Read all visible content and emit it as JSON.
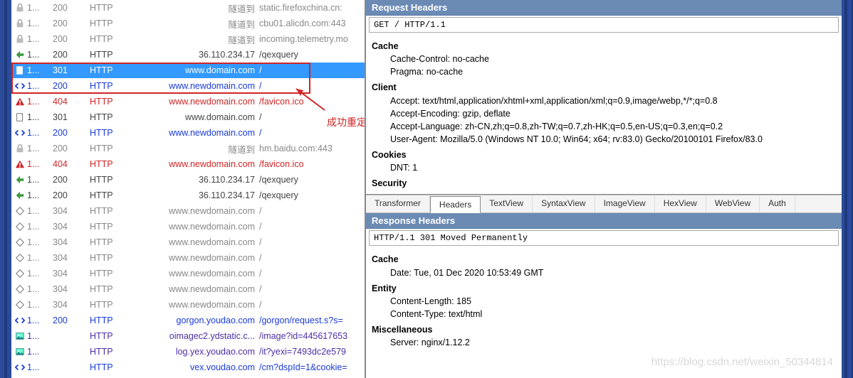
{
  "annotation": "成功重定向",
  "watermark": "https://blog.csdn.net/weixin_50344814",
  "rows": [
    {
      "icon": "lock",
      "num": "1...",
      "status": "200",
      "proto": "HTTP",
      "host": "隧道到",
      "path": "static.firefoxchina.cn:",
      "cls": "gray"
    },
    {
      "icon": "lock",
      "num": "1...",
      "status": "200",
      "proto": "HTTP",
      "host": "隧道到",
      "path": "cbu01.alicdn.com:443",
      "cls": "gray"
    },
    {
      "icon": "lock",
      "num": "1...",
      "status": "200",
      "proto": "HTTP",
      "host": "隧道到",
      "path": "incoming.telemetry.mo",
      "cls": "gray"
    },
    {
      "icon": "send",
      "num": "1...",
      "status": "200",
      "proto": "HTTP",
      "host": "36.110.234.17",
      "path": "/qexquery",
      "cls": ""
    },
    {
      "icon": "page",
      "num": "1...",
      "status": "301",
      "proto": "HTTP",
      "host": "www.domain.com",
      "path": "/",
      "cls": "selected",
      "boxed": true
    },
    {
      "icon": "code",
      "num": "1...",
      "status": "200",
      "proto": "HTTP",
      "host": "www.newdomain.com",
      "path": "/",
      "cls": "blue",
      "boxed": true
    },
    {
      "icon": "warn",
      "num": "1...",
      "status": "404",
      "proto": "HTTP",
      "host": "www.newdomain.com",
      "path": "/favicon.ico",
      "cls": "red"
    },
    {
      "icon": "page",
      "num": "1...",
      "status": "301",
      "proto": "HTTP",
      "host": "www.domain.com",
      "path": "/",
      "cls": ""
    },
    {
      "icon": "code",
      "num": "1...",
      "status": "200",
      "proto": "HTTP",
      "host": "www.newdomain.com",
      "path": "/",
      "cls": "blue"
    },
    {
      "icon": "lock",
      "num": "1...",
      "status": "200",
      "proto": "HTTP",
      "host": "隧道到",
      "path": "hm.baidu.com:443",
      "cls": "gray"
    },
    {
      "icon": "warn",
      "num": "1...",
      "status": "404",
      "proto": "HTTP",
      "host": "www.newdomain.com",
      "path": "/favicon.ico",
      "cls": "red"
    },
    {
      "icon": "send",
      "num": "1...",
      "status": "200",
      "proto": "HTTP",
      "host": "36.110.234.17",
      "path": "/qexquery",
      "cls": ""
    },
    {
      "icon": "send",
      "num": "1...",
      "status": "200",
      "proto": "HTTP",
      "host": "36.110.234.17",
      "path": "/qexquery",
      "cls": ""
    },
    {
      "icon": "diamond",
      "num": "1...",
      "status": "304",
      "proto": "HTTP",
      "host": "www.newdomain.com",
      "path": "/",
      "cls": "gray"
    },
    {
      "icon": "diamond",
      "num": "1...",
      "status": "304",
      "proto": "HTTP",
      "host": "www.newdomain.com",
      "path": "/",
      "cls": "gray"
    },
    {
      "icon": "diamond",
      "num": "1...",
      "status": "304",
      "proto": "HTTP",
      "host": "www.newdomain.com",
      "path": "/",
      "cls": "gray"
    },
    {
      "icon": "diamond",
      "num": "1...",
      "status": "304",
      "proto": "HTTP",
      "host": "www.newdomain.com",
      "path": "/",
      "cls": "gray"
    },
    {
      "icon": "diamond",
      "num": "1...",
      "status": "304",
      "proto": "HTTP",
      "host": "www.newdomain.com",
      "path": "/",
      "cls": "gray"
    },
    {
      "icon": "diamond",
      "num": "1...",
      "status": "304",
      "proto": "HTTP",
      "host": "www.newdomain.com",
      "path": "/",
      "cls": "gray"
    },
    {
      "icon": "diamond",
      "num": "1...",
      "status": "304",
      "proto": "HTTP",
      "host": "www.newdomain.com",
      "path": "/",
      "cls": "gray"
    },
    {
      "icon": "code",
      "num": "1...",
      "status": "200",
      "proto": "HTTP",
      "host": "gorgon.youdao.com",
      "path": "/gorgon/request.s?s=",
      "cls": "blue"
    },
    {
      "icon": "img",
      "num": "1...",
      "status": "",
      "proto": "HTTP",
      "host": "oimagec2.ydstatic.c...",
      "path": "/image?id=445617653",
      "cls": "purple"
    },
    {
      "icon": "img",
      "num": "1...",
      "status": "",
      "proto": "HTTP",
      "host": "log.yex.youdao.com",
      "path": "/it?yexi=7493dc2e579",
      "cls": "purple"
    },
    {
      "icon": "code",
      "num": "1...",
      "status": "",
      "proto": "HTTP",
      "host": "vex.voudao.com",
      "path": "/cm?dspId=1&cookie=",
      "cls": "blue"
    }
  ],
  "request": {
    "title": "Request Headers",
    "line": "GET / HTTP/1.1",
    "groups": [
      {
        "name": "Cache",
        "items": [
          "Cache-Control: no-cache",
          "Pragma: no-cache"
        ]
      },
      {
        "name": "Client",
        "items": [
          "Accept: text/html,application/xhtml+xml,application/xml;q=0.9,image/webp,*/*;q=0.8",
          "Accept-Encoding: gzip, deflate",
          "Accept-Language: zh-CN,zh;q=0.8,zh-TW;q=0.7,zh-HK;q=0.5,en-US;q=0.3,en;q=0.2",
          "User-Agent: Mozilla/5.0 (Windows NT 10.0; Win64; x64; rv:83.0) Gecko/20100101 Firefox/83.0"
        ]
      },
      {
        "name": "Cookies",
        "items": [
          "DNT: 1"
        ]
      },
      {
        "name": "Security",
        "items": []
      }
    ]
  },
  "tabs": [
    "Transformer",
    "Headers",
    "TextView",
    "SyntaxView",
    "ImageView",
    "HexView",
    "WebView",
    "Auth"
  ],
  "activeTab": "Headers",
  "response": {
    "title": "Response Headers",
    "line": "HTTP/1.1 301 Moved Permanently",
    "groups": [
      {
        "name": "Cache",
        "items": [
          "Date: Tue, 01 Dec 2020 10:53:49 GMT"
        ]
      },
      {
        "name": "Entity",
        "items": [
          "Content-Length: 185",
          "Content-Type: text/html"
        ]
      },
      {
        "name": "Miscellaneous",
        "items": [
          "Server: nginx/1.12.2"
        ]
      }
    ]
  }
}
